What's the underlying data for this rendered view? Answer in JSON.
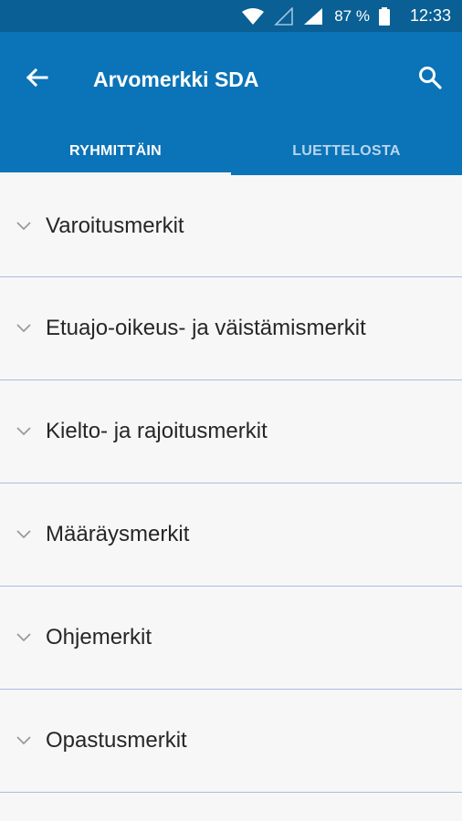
{
  "status_bar": {
    "battery": "87 %",
    "time": "12:33"
  },
  "app_bar": {
    "title": "Arvomerkki SDA",
    "tabs": [
      {
        "label": "RYHMITTÄIN",
        "active": true
      },
      {
        "label": "LUETTELOSTA",
        "active": false
      }
    ]
  },
  "groups": [
    {
      "label": "Varoitusmerkit"
    },
    {
      "label": "Etuajo-oikeus- ja väistämismerkit"
    },
    {
      "label": "Kielto- ja rajoitusmerkit"
    },
    {
      "label": "Määräysmerkit"
    },
    {
      "label": "Ohjemerkit"
    },
    {
      "label": "Opastusmerkit"
    }
  ],
  "colors": {
    "status_bar": "#0a5f94",
    "app_bar": "#0b73b7",
    "divider": "#a9bde0"
  },
  "icons": {
    "back": "arrow-left-icon",
    "search": "search-icon",
    "expand": "chevron-down-icon"
  }
}
